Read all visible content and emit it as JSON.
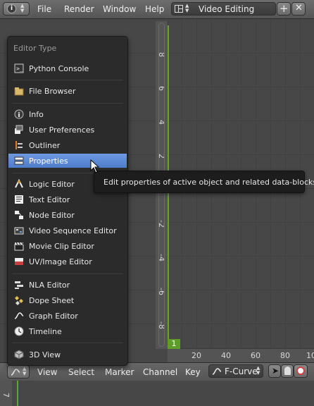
{
  "top_menu": {
    "file": "File",
    "render": "Render",
    "window": "Window",
    "help": "Help",
    "screen_layout": "Video Editing"
  },
  "editor_menu": {
    "title": "Editor Type",
    "items": [
      {
        "label": "Python Console",
        "icon": "python-console-icon"
      },
      {
        "label": "File Browser",
        "icon": "file-browser-icon"
      },
      {
        "label": "Info",
        "icon": "info-icon"
      },
      {
        "label": "User Preferences",
        "icon": "user-preferences-icon"
      },
      {
        "label": "Outliner",
        "icon": "outliner-icon"
      },
      {
        "label": "Properties",
        "icon": "properties-icon",
        "highlighted": true
      },
      {
        "label": "Logic Editor",
        "icon": "logic-editor-icon"
      },
      {
        "label": "Text Editor",
        "icon": "text-editor-icon"
      },
      {
        "label": "Node Editor",
        "icon": "node-editor-icon"
      },
      {
        "label": "Video Sequence Editor",
        "icon": "video-sequence-editor-icon"
      },
      {
        "label": "Movie Clip Editor",
        "icon": "movie-clip-editor-icon"
      },
      {
        "label": "UV/Image Editor",
        "icon": "uv-image-editor-icon"
      },
      {
        "label": "NLA Editor",
        "icon": "nla-editor-icon"
      },
      {
        "label": "Dope Sheet",
        "icon": "dope-sheet-icon"
      },
      {
        "label": "Graph Editor",
        "icon": "graph-editor-icon"
      },
      {
        "label": "Timeline",
        "icon": "timeline-icon"
      },
      {
        "label": "3D View",
        "icon": "3d-view-icon"
      }
    ]
  },
  "tooltip": "Edit properties of active object and related data-blocks.",
  "v_ruler_labels": [
    "8",
    "6",
    "4",
    "2",
    "0",
    "-2",
    "-4",
    "-6",
    "-8"
  ],
  "h_ruler_labels": [
    "20",
    "40",
    "60",
    "80",
    "100"
  ],
  "current_frame": "1",
  "bottom_header": {
    "view": "View",
    "select": "Select",
    "marker": "Marker",
    "channel": "Channel",
    "key": "Key",
    "mode": "F-Curve"
  },
  "bottom_ruler_label": "7",
  "colors": {
    "highlight": "#5680c2",
    "frame_marker": "#5c9e28",
    "background": "#474747"
  }
}
